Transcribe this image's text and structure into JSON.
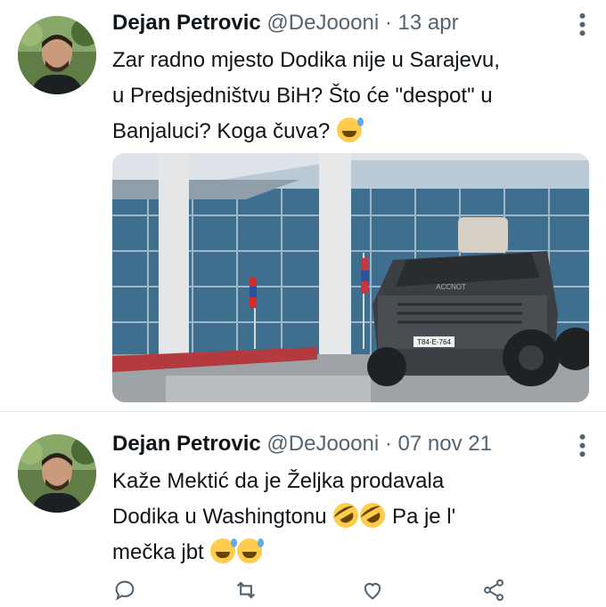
{
  "tweets": [
    {
      "name": "Dejan Petrovic",
      "handle": "@DeJoooni",
      "separator": "·",
      "date": "13 apr",
      "text_lines": [
        "Zar radno mjesto Dodika nije u Sarajevu,",
        "u Predsjedništvu BiH? Što će \"despot\" u",
        "Banjaluci? Koga čuva?"
      ],
      "emoji": [
        "grinning-sweat"
      ],
      "media": {
        "plate": "T84-E-764",
        "brand": "ACCNOT"
      }
    },
    {
      "name": "Dejan Petrovic",
      "handle": "@DeJoooni",
      "separator": "·",
      "date": "07 nov 21",
      "text_line1": "Kaže Mektić da je Željka prodavala",
      "text_line2": "Dodika u Washingtonu",
      "text_line2_tail": "Pa je l'",
      "text_line3": "mečka jbt",
      "emoji": [
        "rofl",
        "rofl",
        "grinning-sweat",
        "grinning-sweat"
      ]
    }
  ],
  "actions": [
    "reply-icon",
    "retweet-icon",
    "like-icon",
    "share-icon"
  ],
  "colors": {
    "text": "#0f1419",
    "secondary": "#536471",
    "divider": "#e6ecf0"
  }
}
